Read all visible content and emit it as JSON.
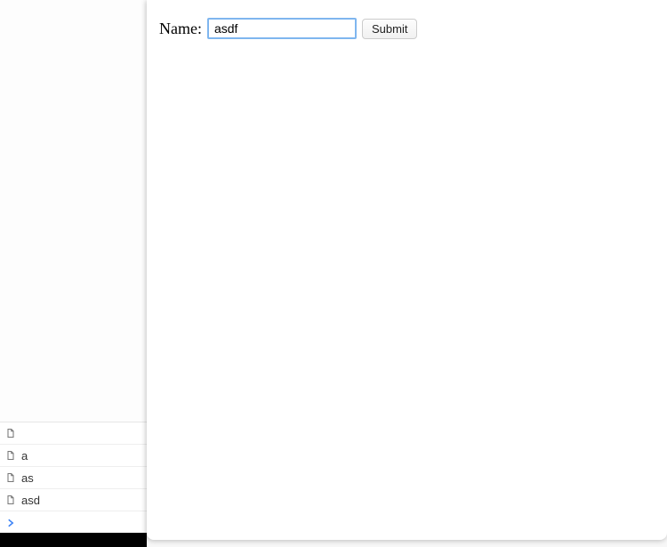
{
  "form": {
    "name_label": "Name:",
    "name_value": "asdf",
    "submit_label": "Submit"
  },
  "devtools": {
    "rows": [
      {
        "label": ""
      },
      {
        "label": "a"
      },
      {
        "label": "as"
      },
      {
        "label": "asd"
      }
    ]
  }
}
